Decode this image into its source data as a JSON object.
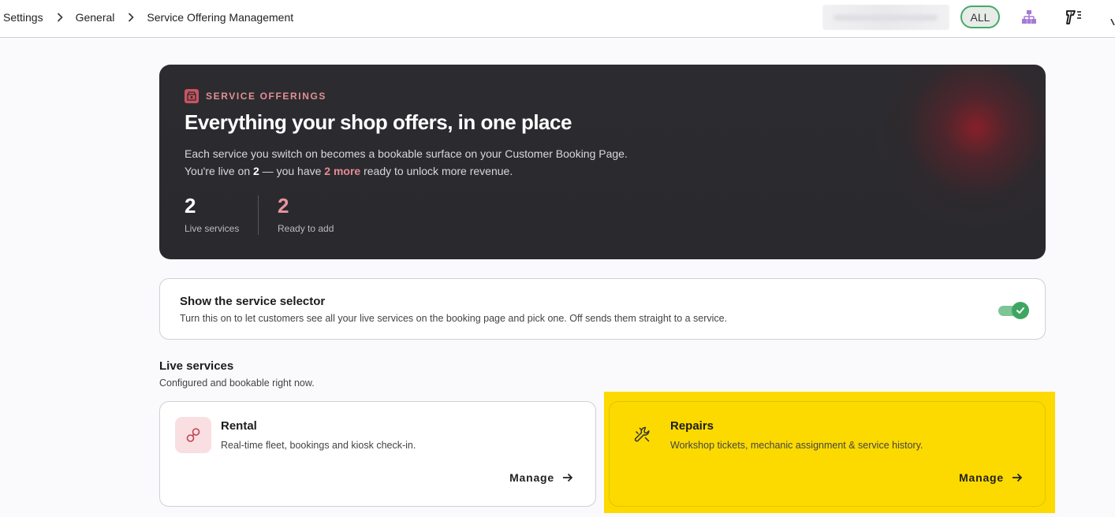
{
  "breadcrumb": {
    "items": [
      "Settings",
      "General",
      "Service Offering Management"
    ]
  },
  "header": {
    "filter_label": "ALL",
    "icons": [
      "org-chart-icon",
      "tool-list-icon"
    ]
  },
  "hero": {
    "eyebrow": "SERVICE OFFERINGS",
    "title": "Everything your shop offers, in one place",
    "line1": "Each service you switch on becomes a bookable surface on your Customer Booking Page.",
    "line2_prefix": "You're live on ",
    "line2_live": "2",
    "line2_mid": " — you have ",
    "line2_more": "2 more",
    "line2_suffix": " ready to unlock more revenue.",
    "stats": [
      {
        "value": "2",
        "label": "Live services"
      },
      {
        "value": "2",
        "label": "Ready to add"
      }
    ],
    "accent_color": "#e58b96"
  },
  "selector": {
    "title": "Show the service selector",
    "description": "Turn this on to let customers see all your live services on the booking page and pick one. Off sends them straight to a service.",
    "enabled": true
  },
  "live_services": {
    "title": "Live services",
    "subtitle": "Configured and bookable right now.",
    "cards": [
      {
        "name": "Rental",
        "description": "Real-time fleet, bookings and kiosk check-in.",
        "action": "Manage",
        "icon": "link-icon"
      },
      {
        "name": "Repairs",
        "description": "Workshop tickets, mechanic assignment & service history.",
        "action": "Manage",
        "icon": "wrench-icon",
        "highlight_color": "#fcda00"
      }
    ]
  }
}
